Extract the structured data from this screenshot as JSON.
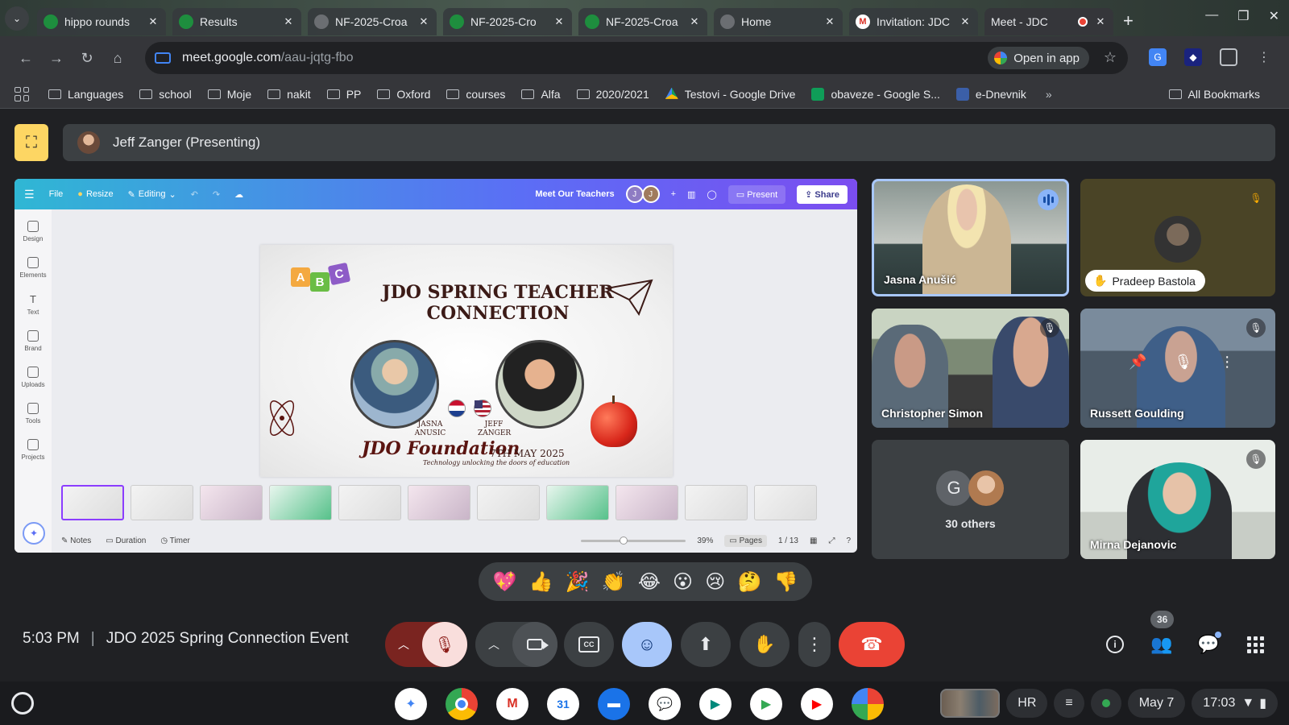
{
  "browser": {
    "tabs": [
      {
        "title": "hippo rounds",
        "icon": "green"
      },
      {
        "title": "Results",
        "icon": "green"
      },
      {
        "title": "NF-2025-Croa",
        "icon": "grey"
      },
      {
        "title": "NF-2025-Cro",
        "icon": "green"
      },
      {
        "title": "NF-2025-Croa",
        "icon": "green"
      },
      {
        "title": "Home",
        "icon": "grey"
      },
      {
        "title": "Invitation: JDC",
        "icon": "gmail"
      },
      {
        "title": "Meet - JDC",
        "icon": "meet"
      }
    ],
    "url_host": "meet.google.com",
    "url_path": "/aau-jqtg-fbo",
    "open_in_app": "Open in app",
    "bookmarks": [
      "Languages",
      "school",
      "Moje",
      "nakit",
      "PP",
      "Oxford",
      "courses",
      "Alfa",
      "2020/2021",
      "Testovi - Google Drive",
      "obaveze - Google S...",
      "e-Dnevnik"
    ],
    "all_bookmarks": "All Bookmarks"
  },
  "meet": {
    "presenter": "Jeff Zanger (Presenting)",
    "canva": {
      "file": "File",
      "resize": "Resize",
      "editing": "Editing",
      "doc_title": "Meet Our Teachers",
      "collab1": "J",
      "collab2": "J",
      "present": "Present",
      "share": "Share",
      "rail": [
        "Design",
        "Elements",
        "Text",
        "Brand",
        "Uploads",
        "Tools",
        "Projects"
      ],
      "notes": "Notes",
      "duration": "Duration",
      "timer": "Timer",
      "zoom": "39%",
      "pages": "Pages",
      "page_count": "1 / 13"
    },
    "slide": {
      "title": "JDO SPRING TEACHER CONNECTION",
      "cubes": [
        "A",
        "B",
        "C"
      ],
      "person1": "JASNA ANUSIC",
      "person2": "JEFF ZANGER",
      "foundation": "JDO Foundation",
      "date": "7TH MAY 2025",
      "tagline": "Technology unlocking the doors of education"
    },
    "participants": {
      "p1": "Jasna Anušić",
      "p2": "Pradeep Bastola",
      "p3": "Christopher Simon",
      "p4": "Russett Goulding",
      "others_initial": "G",
      "others": "30 others",
      "p6": "Mirna Dejanovic"
    },
    "reactions": [
      "💖",
      "👍",
      "🎉",
      "👏",
      "😂",
      "😮",
      "😢",
      "🤔",
      "👎"
    ],
    "time": "5:03 PM",
    "meeting_title": "JDO 2025 Spring Connection Event",
    "participant_count": "36"
  },
  "shelf": {
    "calendar_day": "31",
    "lang": "HR",
    "date": "May 7",
    "clock": "17:03"
  }
}
